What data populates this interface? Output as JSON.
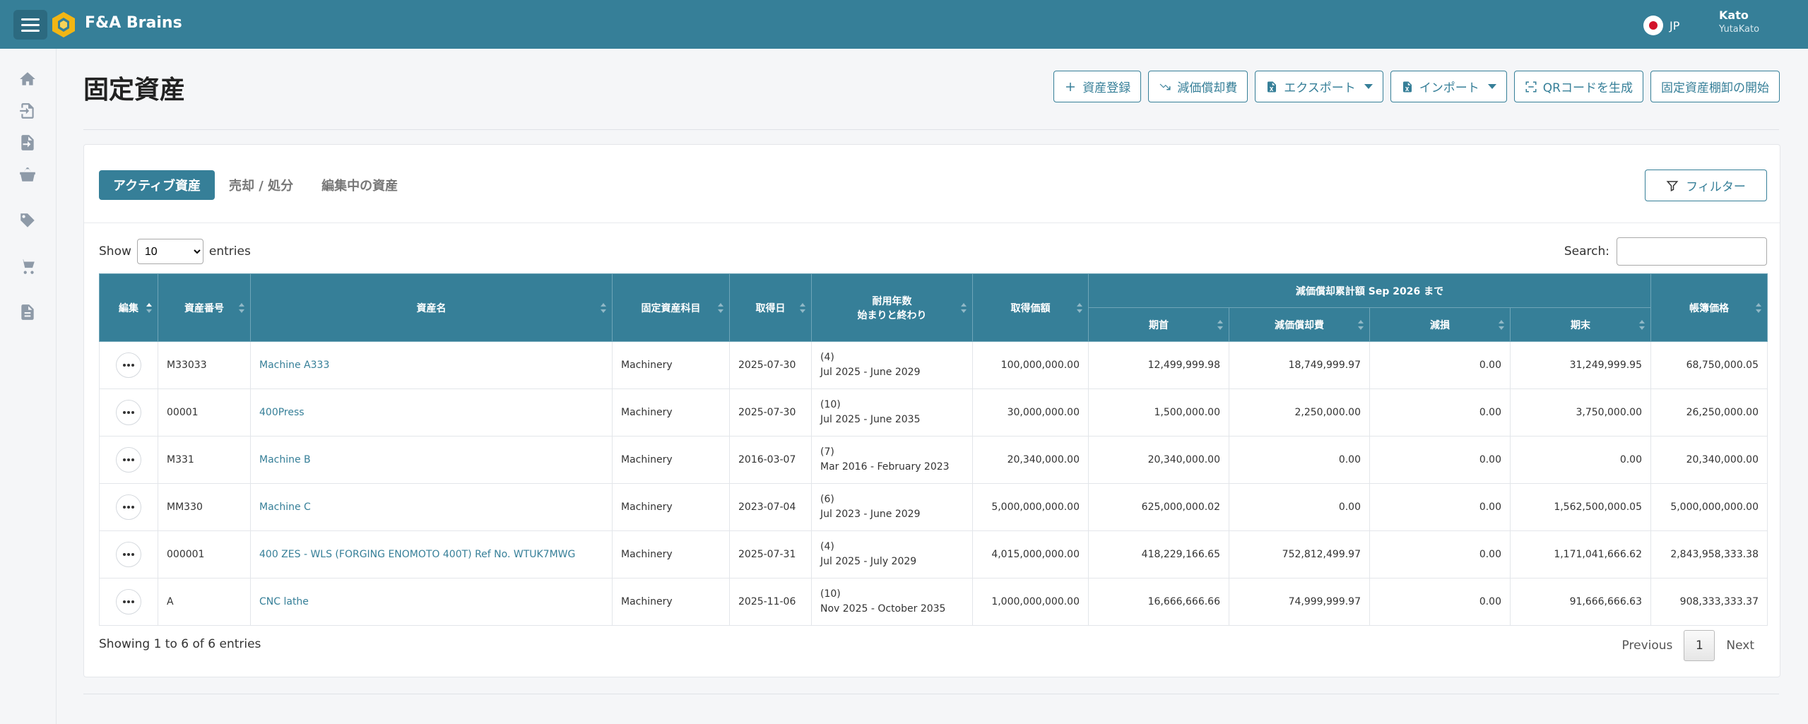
{
  "app": {
    "brand": "F&A Brains"
  },
  "header": {
    "lang": "JP",
    "user_name": "Kato",
    "user_id": "YutaKato"
  },
  "sidebar": {
    "icons": [
      "home-icon",
      "import-file-icon",
      "export-file-icon",
      "basket-icon",
      "tag-icon",
      "cart-icon",
      "document-icon"
    ]
  },
  "page": {
    "title": "固定資産"
  },
  "actions": {
    "register": "資産登録",
    "depreciation": "減価償却費",
    "export": "エクスポート",
    "import": "インポート",
    "qr": "QRコードを生成",
    "inventory": "固定資産棚卸の開始"
  },
  "tabs": [
    "アクティブ資産",
    "売却 / 処分",
    "編集中の資産"
  ],
  "filter_label": "フィルター",
  "table_controls": {
    "show": "Show",
    "entries": "entries",
    "page_length": "10",
    "search_label": "Search:",
    "showing": "Showing 1 to 6 of 6 entries",
    "prev": "Previous",
    "next": "Next",
    "page": "1"
  },
  "columns": {
    "edit": "編集",
    "asset_no": "資産番号",
    "asset_name": "資産名",
    "account": "固定資産科目",
    "acquired": "取得日",
    "life_line1": "耐用年数",
    "life_line2": "始まりと終わり",
    "acq_value": "取得価額",
    "accum_group": "減価償却累計額 Sep 2026 まで",
    "opening": "期首",
    "depreciation": "減価償却費",
    "impairment": "減損",
    "closing": "期末",
    "book_value": "帳簿価格"
  },
  "rows": [
    {
      "asset_no": "M33033",
      "name": "Machine A333",
      "account": "Machinery",
      "acquired": "2025-07-30",
      "life_years": "(4)",
      "life_range": "Jul 2025 - June 2029",
      "acq_value": "100,000,000.00",
      "opening": "12,499,999.98",
      "depreciation": "18,749,999.97",
      "impairment": "0.00",
      "closing": "31,249,999.95",
      "book_value": "68,750,000.05"
    },
    {
      "asset_no": "00001",
      "name": "400Press",
      "account": "Machinery",
      "acquired": "2025-07-30",
      "life_years": "(10)",
      "life_range": "Jul 2025 - June 2035",
      "acq_value": "30,000,000.00",
      "opening": "1,500,000.00",
      "depreciation": "2,250,000.00",
      "impairment": "0.00",
      "closing": "3,750,000.00",
      "book_value": "26,250,000.00"
    },
    {
      "asset_no": "M331",
      "name": "Machine B",
      "account": "Machinery",
      "acquired": "2016-03-07",
      "life_years": "(7)",
      "life_range": "Mar 2016 - February 2023",
      "acq_value": "20,340,000.00",
      "opening": "20,340,000.00",
      "depreciation": "0.00",
      "impairment": "0.00",
      "closing": "0.00",
      "book_value": "20,340,000.00"
    },
    {
      "asset_no": "MM330",
      "name": "Machine C",
      "account": "Machinery",
      "acquired": "2023-07-04",
      "life_years": "(6)",
      "life_range": "Jul 2023 - June 2029",
      "acq_value": "5,000,000,000.00",
      "opening": "625,000,000.02",
      "depreciation": "0.00",
      "impairment": "0.00",
      "closing": "1,562,500,000.05",
      "book_value": "5,000,000,000.00"
    },
    {
      "asset_no": "000001",
      "name": "400 ZES - WLS (FORGING ENOMOTO 400T) Ref No. WTUK7MWG",
      "account": "Machinery",
      "acquired": "2025-07-31",
      "life_years": "(4)",
      "life_range": "Jul 2025 - July 2029",
      "acq_value": "4,015,000,000.00",
      "opening": "418,229,166.65",
      "depreciation": "752,812,499.97",
      "impairment": "0.00",
      "closing": "1,171,041,666.62",
      "book_value": "2,843,958,333.38"
    },
    {
      "asset_no": "A",
      "name": "CNC lathe",
      "account": "Machinery",
      "acquired": "2025-11-06",
      "life_years": "(10)",
      "life_range": "Nov 2025 - October 2035",
      "acq_value": "1,000,000,000.00",
      "opening": "16,666,666.66",
      "depreciation": "74,999,999.97",
      "impairment": "0.00",
      "closing": "91,666,666.63",
      "book_value": "908,333,333.37"
    }
  ],
  "colors": {
    "primary": "#367f98",
    "link": "#367f98"
  }
}
